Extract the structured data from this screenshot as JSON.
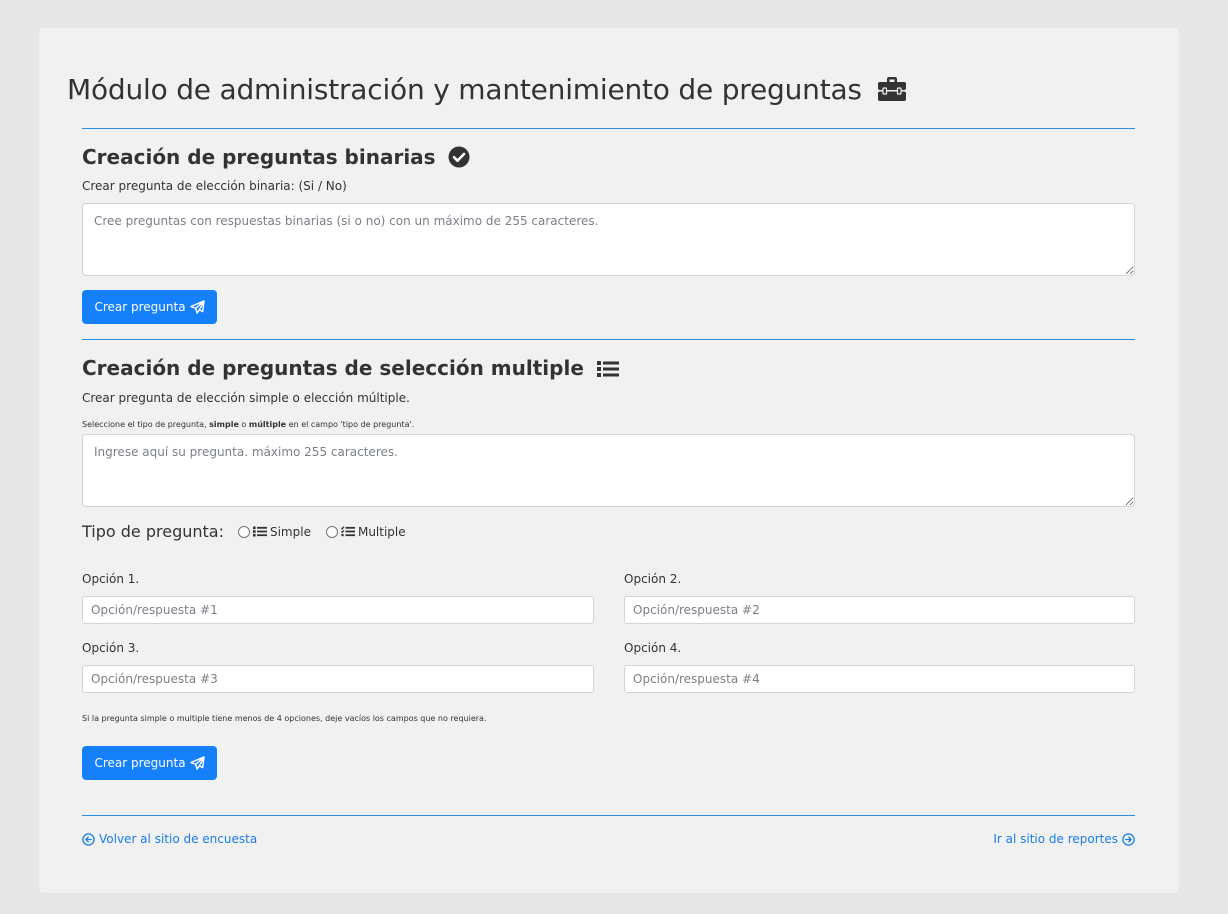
{
  "header": {
    "title": "Módulo de administración y mantenimiento de preguntas",
    "icon": "toolbox-icon"
  },
  "binary": {
    "title": "Creación de preguntas binarias",
    "title_icon": "check-circle-icon",
    "subtitle": "Crear pregunta de elección binaria: (Si / No)",
    "placeholder": "Cree preguntas con respuestas binarias (si o no) con un máximo de 255 caracteres.",
    "button_label": "Crear pregunta",
    "button_icon": "paper-plane-icon"
  },
  "multiple": {
    "title": "Creación de preguntas de selección multiple",
    "title_icon": "list-icon",
    "subtitle": "Crear pregunta de elección simple o elección múltiple.",
    "hint_prefix": "Seleccione el tipo de pregunta, ",
    "hint_simple": "simple",
    "hint_mid": " o ",
    "hint_multiple": "múltiple",
    "hint_suffix": " en el campo 'tipo de pregunta'.",
    "placeholder": "Ingrese aquí su pregunta. máximo 255 caracteres.",
    "type_label": "Tipo de pregunta:",
    "type_options": [
      {
        "label": "Simple",
        "icon": "list-icon"
      },
      {
        "label": "Multiple",
        "icon": "list-check-icon"
      }
    ],
    "options": [
      {
        "label": "Opción 1.",
        "placeholder": "Opción/respuesta #1"
      },
      {
        "label": "Opción 2.",
        "placeholder": "Opción/respuesta #2"
      },
      {
        "label": "Opción 3.",
        "placeholder": "Opción/respuesta #3"
      },
      {
        "label": "Opción 4.",
        "placeholder": "Opción/respuesta #4"
      }
    ],
    "note": "Si la pregunta simple o multiple tiene menos de 4 opciones, deje vacíos los campos que no requiera.",
    "button_label": "Crear pregunta",
    "button_icon": "paper-plane-icon"
  },
  "footer": {
    "back_label": "Volver al sitio de encuesta",
    "back_icon": "arrow-circle-left-icon",
    "reports_label": "Ir al sitio de reportes",
    "reports_icon": "arrow-circle-right-icon"
  },
  "colors": {
    "accent": "#1580f9",
    "link": "#1a7ee6",
    "divider": "#2b8fe0",
    "card_bg": "#f1f1f2",
    "page_bg": "#e6e6e6"
  }
}
